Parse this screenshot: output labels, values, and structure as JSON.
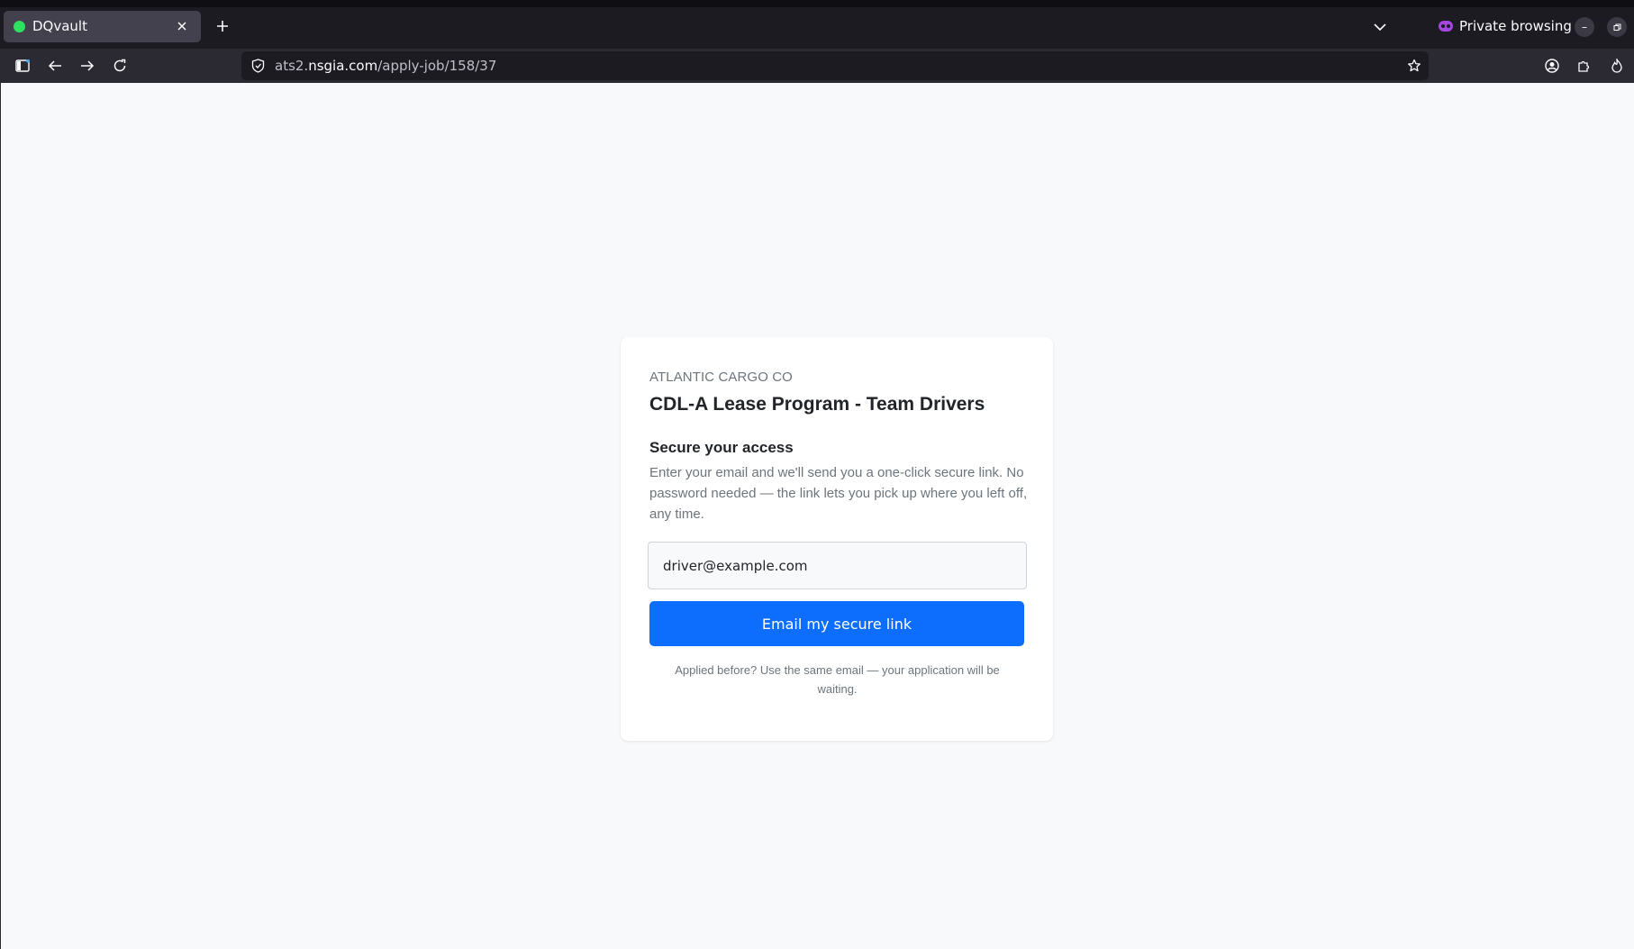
{
  "browser": {
    "tab": {
      "title": "DQvault",
      "favicon_color": "#30e060"
    },
    "private_label": "Private browsing",
    "url": {
      "host_prefix": "ats2.",
      "host": "nsgia.com",
      "path": "/apply-job/158/37"
    }
  },
  "page": {
    "company": "ATLANTIC CARGO CO",
    "job_title": "CDL-A Lease Program - Team Drivers",
    "section_title": "Secure your access",
    "description": "Enter your email and we'll send you a one-click secure link. No password needed — the link lets you pick up where you left off, any time.",
    "email_placeholder": "driver@example.com",
    "email_value": "",
    "submit_label": "Email my secure link",
    "footnote": "Applied before? Use the same email — your application will be waiting.",
    "accent_color": "#0d6efd"
  }
}
